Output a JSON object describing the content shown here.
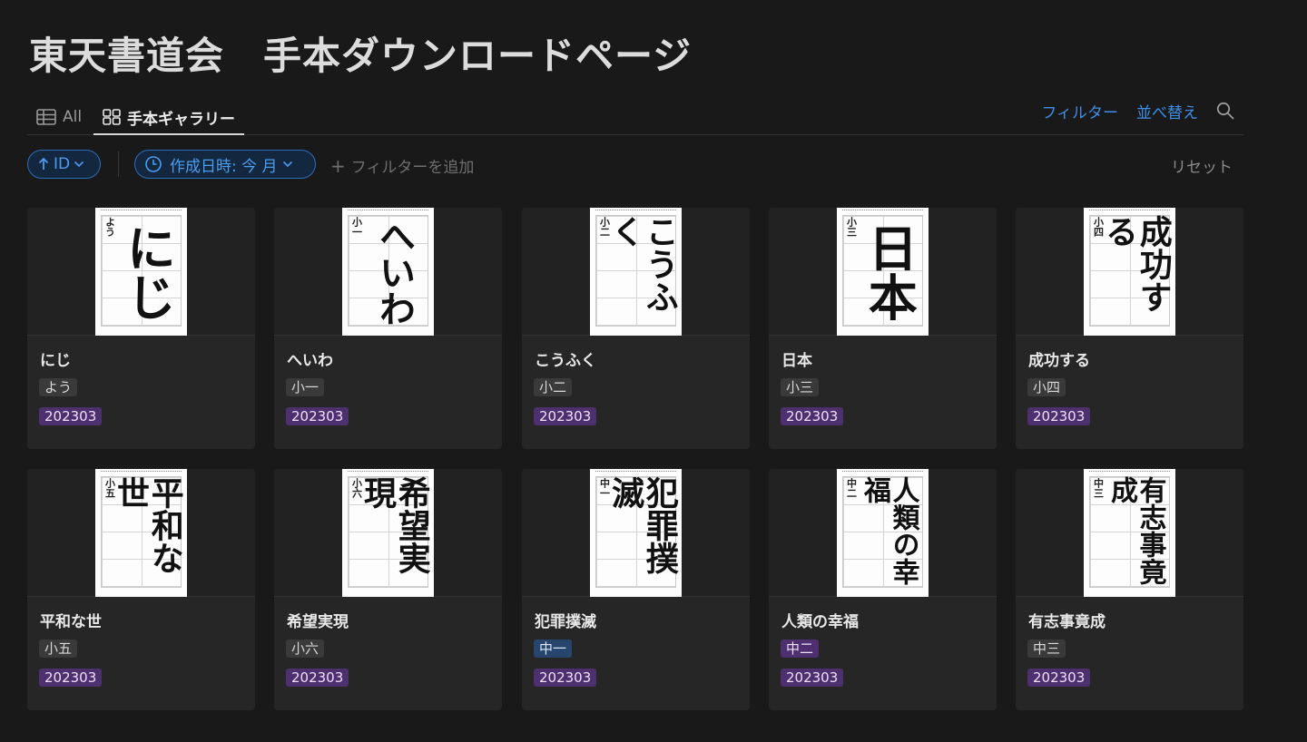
{
  "page": {
    "title": "東天書道会　手本ダウンロードページ"
  },
  "views": {
    "all_label": "All",
    "gallery_label": "手本ギャラリー"
  },
  "actions": {
    "filter_label": "フィルター",
    "sort_label": "並べ替え",
    "search_icon": "search-icon"
  },
  "filters": {
    "sort_chip": "ID",
    "date_chip": "作成日時: 今 月",
    "add_filter": "フィルターを追加",
    "reset": "リセット"
  },
  "colors": {
    "accent_blue": "#3f8ee6",
    "tag_purple": "#4e2f6f",
    "tag_blue": "#28456e",
    "tag_gray": "#3a3a3a"
  },
  "cards": [
    {
      "title": "にじ",
      "grade": "よう",
      "grade_color": "gray",
      "month": "202303",
      "brush": "にじ",
      "mark": "よう"
    },
    {
      "title": "へいわ",
      "grade": "小一",
      "grade_color": "gray",
      "month": "202303",
      "brush": "へいわ",
      "mark": "小一"
    },
    {
      "title": "こうふく",
      "grade": "小二",
      "grade_color": "gray",
      "month": "202303",
      "brush": "こうふく",
      "mark": "小二"
    },
    {
      "title": "日本",
      "grade": "小三",
      "grade_color": "gray",
      "month": "202303",
      "brush": "日本",
      "mark": "小三"
    },
    {
      "title": "成功する",
      "grade": "小四",
      "grade_color": "gray",
      "month": "202303",
      "brush": "成功する",
      "mark": "小四"
    },
    {
      "title": "平和な世",
      "grade": "小五",
      "grade_color": "gray",
      "month": "202303",
      "brush": "平和な世",
      "mark": "小五"
    },
    {
      "title": "希望実現",
      "grade": "小六",
      "grade_color": "gray",
      "month": "202303",
      "brush": "希望実現",
      "mark": "小六"
    },
    {
      "title": "犯罪撲滅",
      "grade": "中一",
      "grade_color": "blue",
      "month": "202303",
      "brush": "犯罪撲滅",
      "mark": "中一"
    },
    {
      "title": "人類の幸福",
      "grade": "中二",
      "grade_color": "purple",
      "month": "202303",
      "brush": "人類の幸福",
      "mark": "中二"
    },
    {
      "title": "有志事竟成",
      "grade": "中三",
      "grade_color": "gray",
      "month": "202303",
      "brush": "有志事竟成",
      "mark": "中三"
    }
  ]
}
